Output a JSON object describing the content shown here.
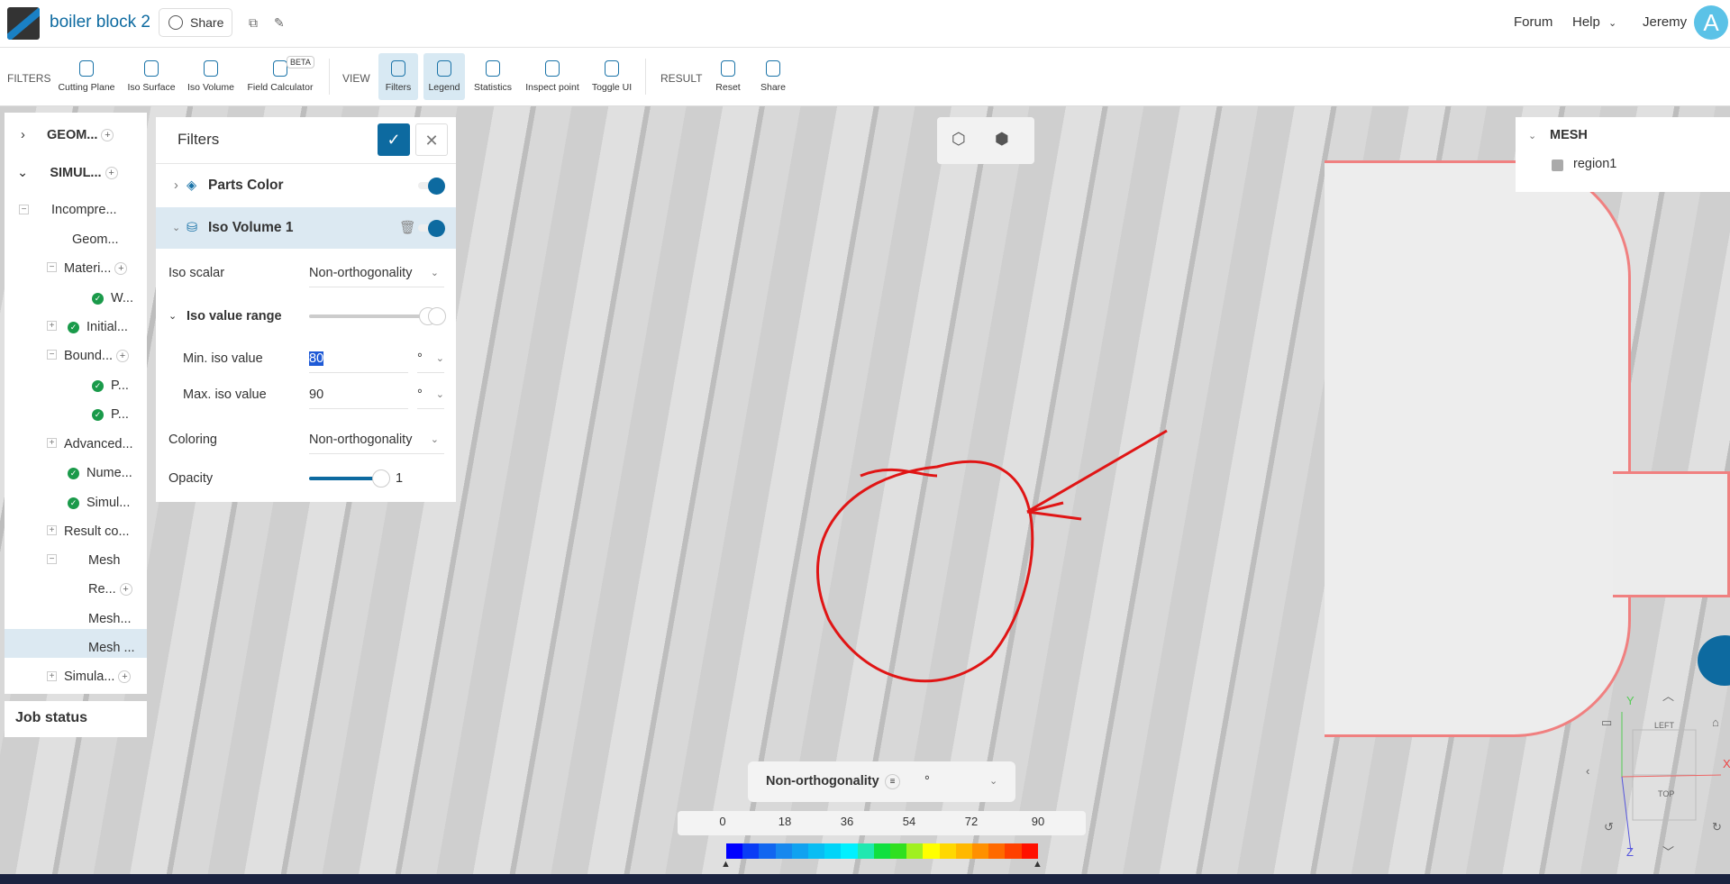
{
  "header": {
    "title": "boiler block 2",
    "share_label": "Share",
    "forum": "Forum",
    "help": "Help",
    "user": "Jeremy",
    "avatar_letter": "A"
  },
  "toolbar": {
    "filters_section": "FILTERS",
    "view_section": "VIEW",
    "result_section": "RESULT",
    "beta": "BETA",
    "tools": [
      "Cutting Plane",
      "Iso Surface",
      "Iso Volume",
      "Field Calculator",
      "Filters",
      "Legend",
      "Statistics",
      "Inspect point",
      "Toggle UI",
      "Reset",
      "Share"
    ]
  },
  "tree": {
    "items": [
      "GEOM...",
      "SIMUL...",
      "Incompre...",
      "Geom...",
      "Materi...",
      "W...",
      "Initial...",
      "Bound...",
      "P...",
      "P...",
      "Advanced...",
      "Nume...",
      "Simul...",
      "Result co...",
      "Mesh",
      "Re...",
      "Mesh...",
      "Mesh ...",
      "Simula..."
    ],
    "job_status": "Job status"
  },
  "filters": {
    "title": "Filters",
    "parts_color": "Parts Color",
    "iso_volume": "Iso Volume 1",
    "iso_scalar_label": "Iso scalar",
    "iso_scalar": "Non-orthogonality",
    "range_label": "Iso value range",
    "min_label": "Min. iso value",
    "min": "80",
    "max_label": "Max. iso value",
    "max": "90",
    "unit": "°",
    "coloring_label": "Coloring",
    "coloring": "Non-orthogonality",
    "opacity_label": "Opacity",
    "opacity": "1"
  },
  "mesh_panel": {
    "title": "MESH",
    "region": "region1"
  },
  "legend": {
    "title": "Non-orthogonality",
    "unit": "°",
    "ticks": [
      "0",
      "18",
      "36",
      "54",
      "72",
      "90"
    ],
    "colors": [
      "#0000ff",
      "#0a3cf5",
      "#1166f0",
      "#1788ee",
      "#10a2f0",
      "#08bdf3",
      "#00d4f8",
      "#00f0ff",
      "#20e8b0",
      "#10e040",
      "#30e020",
      "#a0f020",
      "#ffff00",
      "#ffd800",
      "#ffb800",
      "#ff9000",
      "#ff6a00",
      "#ff4000",
      "#ff1000"
    ]
  },
  "gizmo": {
    "left": "LEFT",
    "top": "TOP",
    "x": "X",
    "y": "Y",
    "z": "Z"
  }
}
